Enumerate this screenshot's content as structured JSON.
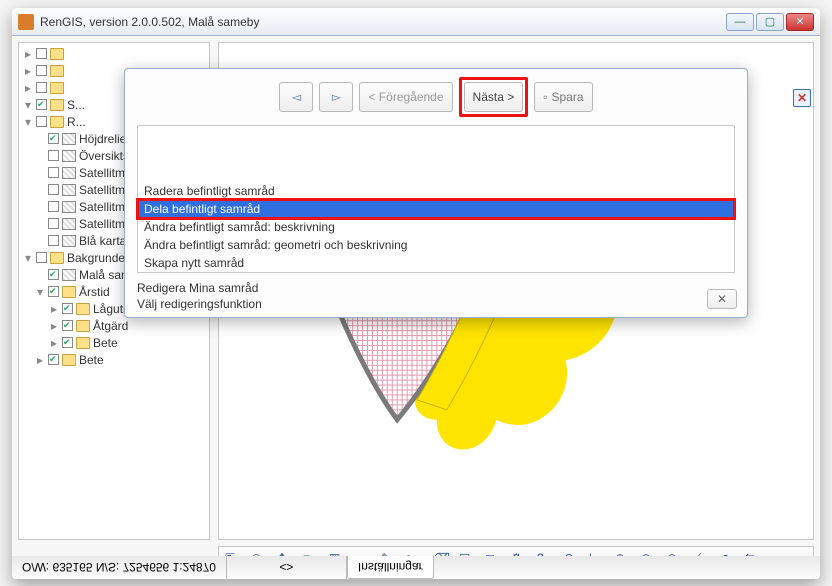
{
  "window": {
    "title": "RenGIS, version 2.0.0.502, Malå sameby",
    "min": "—",
    "max": "▢",
    "close": "✕"
  },
  "statusbar": {
    "coords": "O/W: 635165 N/S: 7254656 1:24870",
    "mid": "<>",
    "settings": "Inställningar"
  },
  "tree": {
    "items": [
      {
        "ind": 1,
        "tw": "▸",
        "cb": true,
        "ic": "fic",
        "label": "Bete"
      },
      {
        "ind": 2,
        "tw": "▸",
        "cb": true,
        "ic": "fic",
        "label": "Bete"
      },
      {
        "ind": 2,
        "tw": "▸",
        "cb": true,
        "ic": "fic",
        "label": "Åtgärd"
      },
      {
        "ind": 2,
        "tw": "▸",
        "cb": true,
        "ic": "fic",
        "label": "Lågutnyttja..."
      },
      {
        "ind": 1,
        "tw": "▾",
        "cb": true,
        "ic": "fic",
        "label": "Årstid"
      },
      {
        "ind": 1,
        "tw": "",
        "cb": true,
        "ic": "lay",
        "label": "Malå sameby (..."
      },
      {
        "ind": 0,
        "tw": "▾",
        "cb": false,
        "ic": "fic",
        "label": "Bakgrunder"
      },
      {
        "ind": 1,
        "tw": "",
        "cb": false,
        "ic": "lay",
        "label": "Blå kartan"
      },
      {
        "ind": 1,
        "tw": "",
        "cb": false,
        "ic": "lay",
        "label": "Satellitmosaik ..."
      },
      {
        "ind": 1,
        "tw": "",
        "cb": false,
        "ic": "lay",
        "label": "Satellitmosaik ..."
      },
      {
        "ind": 1,
        "tw": "",
        "cb": false,
        "ic": "lay",
        "label": "Satellitmosaik ..."
      },
      {
        "ind": 1,
        "tw": "",
        "cb": false,
        "ic": "lay",
        "label": "Satellitmosaik ..."
      },
      {
        "ind": 1,
        "tw": "",
        "cb": false,
        "ic": "lay",
        "label": "Översiktskarta"
      },
      {
        "ind": 1,
        "tw": "",
        "cb": true,
        "ic": "lay",
        "label": "Höjdrelief"
      },
      {
        "ind": 0,
        "tw": "▾",
        "cb": false,
        "ic": "fic",
        "label": "R..."
      },
      {
        "ind": 0,
        "tw": "▾",
        "cb": true,
        "ic": "fic",
        "label": "S..."
      },
      {
        "ind": 0,
        "tw": "▸",
        "cb": false,
        "ic": "fic",
        "label": ""
      },
      {
        "ind": 0,
        "tw": "▸",
        "cb": false,
        "ic": "fic",
        "label": ""
      },
      {
        "ind": 0,
        "tw": "▸",
        "cb": false,
        "ic": "fic",
        "label": ""
      }
    ]
  },
  "dialog": {
    "title": "Redigera Mina samråd",
    "subtitle": "Välj redigeringsfunktion",
    "options": [
      "Skapa nytt samråd",
      "Ändra befintligt samråd: geometri och beskrivning",
      "Ändra befintligt samråd: beskrivning",
      "Dela befintligt samråd",
      "Radera befintligt samråd"
    ],
    "selected_index": 3,
    "btn_prev": "< Föregående",
    "btn_next": "Nästa >",
    "btn_save": "Spara",
    "btn_close": "✕"
  },
  "map_close": "✕",
  "toolbar_icons": [
    "⇱",
    "◎",
    "✥",
    "■",
    "▦",
    "◐",
    "✎",
    "✂",
    "⌫",
    "▤",
    "◻",
    "⚙",
    "?",
    "↶",
    "|",
    "⊕",
    "⊘",
    "⊙",
    "⟋",
    "↗",
    "⇆"
  ]
}
